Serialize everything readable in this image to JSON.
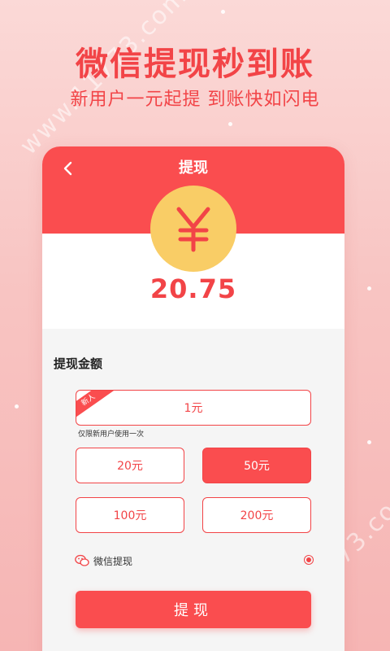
{
  "promo": {
    "title": "微信提现秒到账",
    "subtitle": "新用户一元起提 到账快如闪电"
  },
  "watermark": "www.11773.com",
  "header": {
    "title": "提现",
    "back_icon": "chevron-left-icon",
    "coin_icon": "yen-icon",
    "balance": "20.75"
  },
  "withdraw": {
    "section_label": "提现金额",
    "new_badge": "新人",
    "options": [
      "1元",
      "20元",
      "50元",
      "100元",
      "200元"
    ],
    "selected": "50元",
    "new_user_note": "仅限新用户使用一次"
  },
  "payment_method": {
    "icon": "wechat-icon",
    "label": "微信提现",
    "selected": true
  },
  "submit": {
    "label": "提现"
  },
  "colors": {
    "accent": "#fa4d4f",
    "text_red": "#f24447",
    "coin": "#f9cd66",
    "background": "#f8c4c2"
  }
}
